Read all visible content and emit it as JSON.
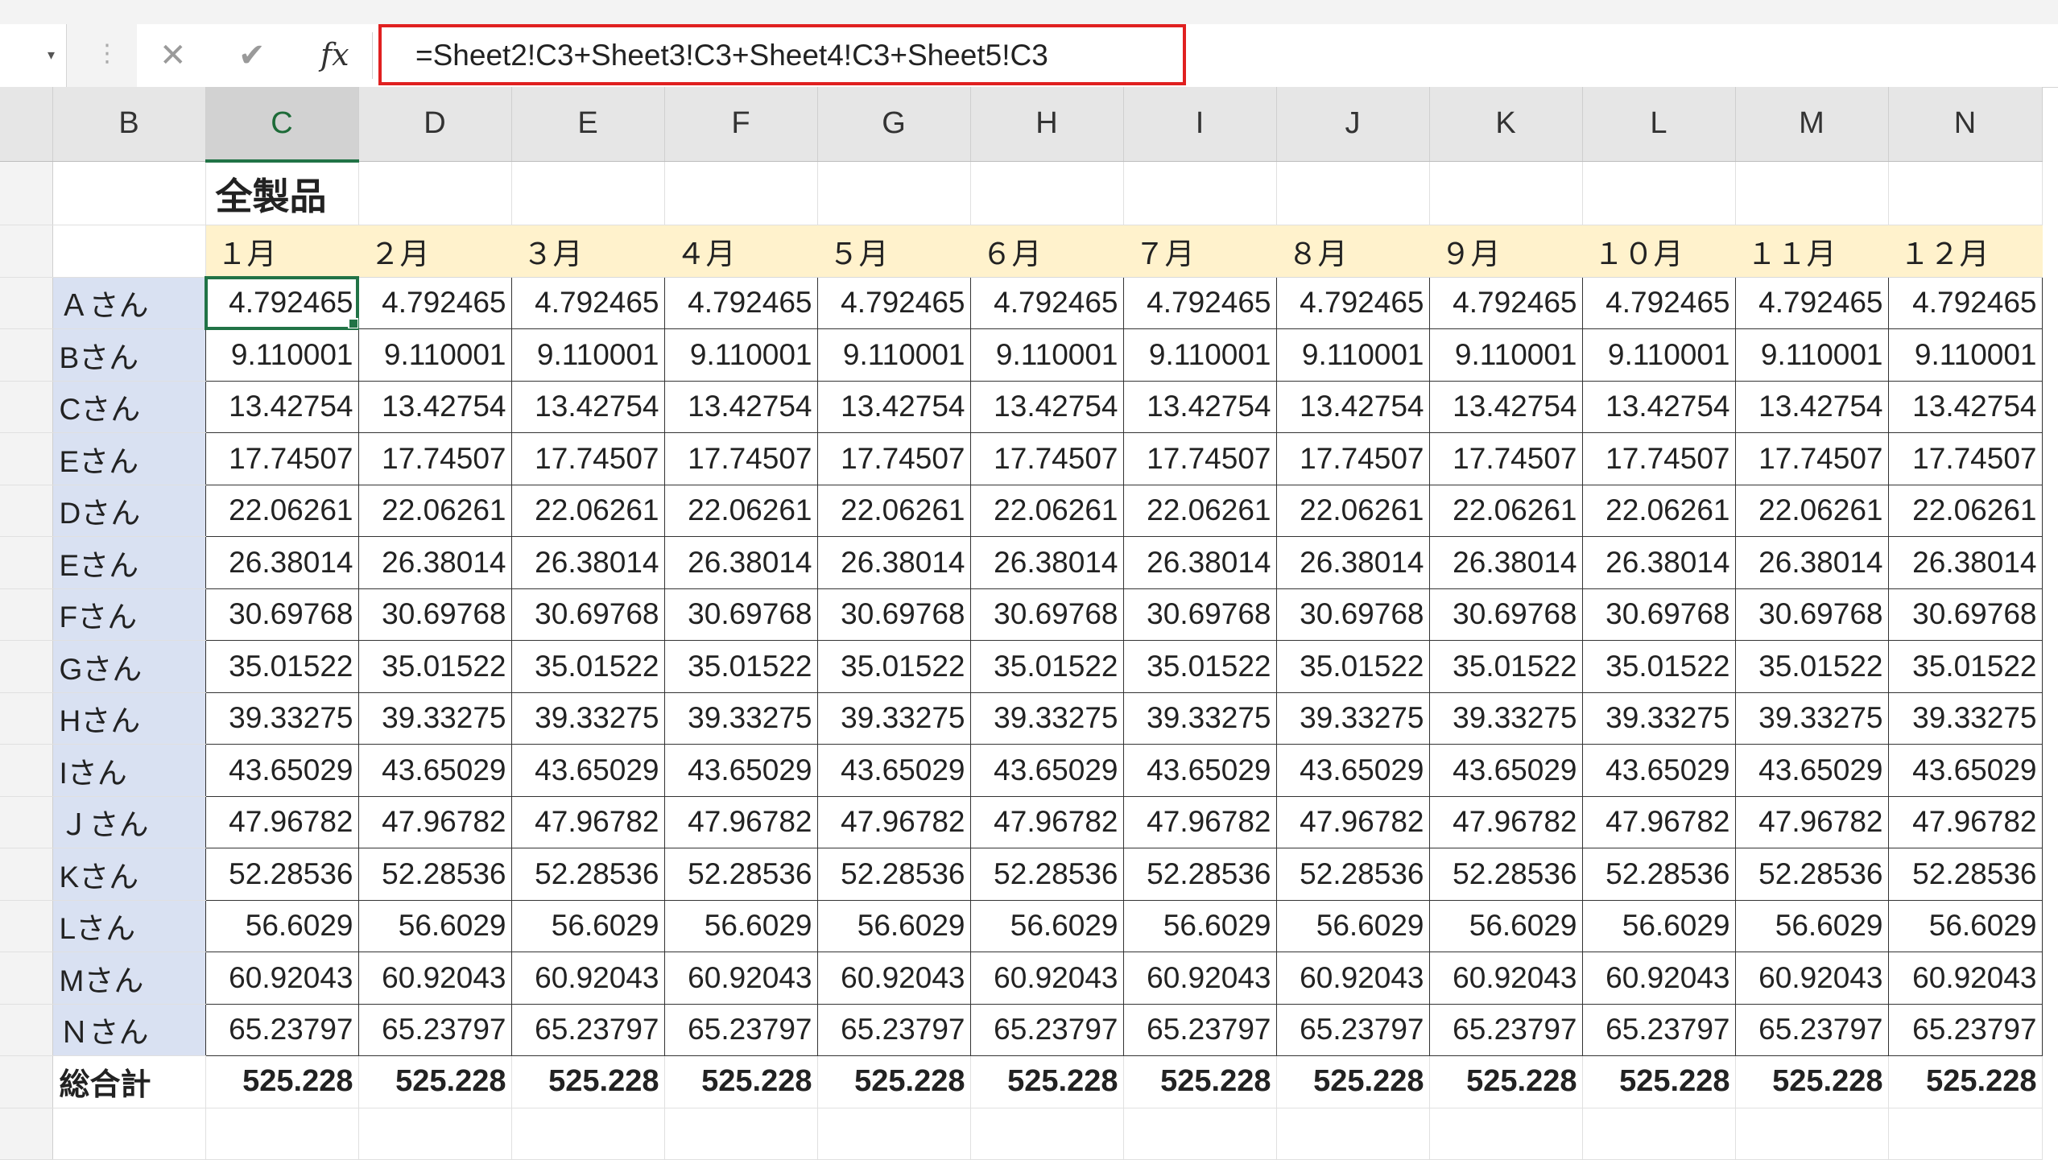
{
  "formula_bar": {
    "name_box": "",
    "cancel_icon": "✕",
    "enter_icon": "✔",
    "fx_label": "fx",
    "formula": "=Sheet2!C3+Sheet3!C3+Sheet4!C3+Sheet5!C3"
  },
  "columns": [
    "B",
    "C",
    "D",
    "E",
    "F",
    "G",
    "H",
    "I",
    "J",
    "K",
    "L",
    "M",
    "N"
  ],
  "selected_column": "C",
  "sheet": {
    "title": "全製品",
    "months": [
      "１月",
      "２月",
      "３月",
      "４月",
      "５月",
      "６月",
      "７月",
      "８月",
      "９月",
      "１０月",
      "１１月",
      "１２月"
    ],
    "rows": [
      {
        "name": "Ａさん",
        "value": "4.792465"
      },
      {
        "name": "Bさん",
        "value": "9.110001"
      },
      {
        "name": "Cさん",
        "value": "13.42754"
      },
      {
        "name": "Eさん",
        "value": "17.74507"
      },
      {
        "name": "Dさん",
        "value": "22.06261"
      },
      {
        "name": "Eさん",
        "value": "26.38014"
      },
      {
        "name": "Fさん",
        "value": "30.69768"
      },
      {
        "name": "Gさん",
        "value": "35.01522"
      },
      {
        "name": "Hさん",
        "value": "39.33275"
      },
      {
        "name": "Iさん",
        "value": "43.65029"
      },
      {
        "name": "Ｊさん",
        "value": "47.96782"
      },
      {
        "name": "Kさん",
        "value": "52.28536"
      },
      {
        "name": "Lさん",
        "value": "56.6029"
      },
      {
        "name": "Mさん",
        "value": "60.92043"
      },
      {
        "name": "Ｎさん",
        "value": "65.23797"
      }
    ],
    "total_label": "総合計",
    "total_value": "525.228"
  },
  "colors": {
    "accent_green": "#217346",
    "highlight_red": "#e02020",
    "name_fill": "#d9e1f2",
    "month_fill": "#fff2cc"
  }
}
